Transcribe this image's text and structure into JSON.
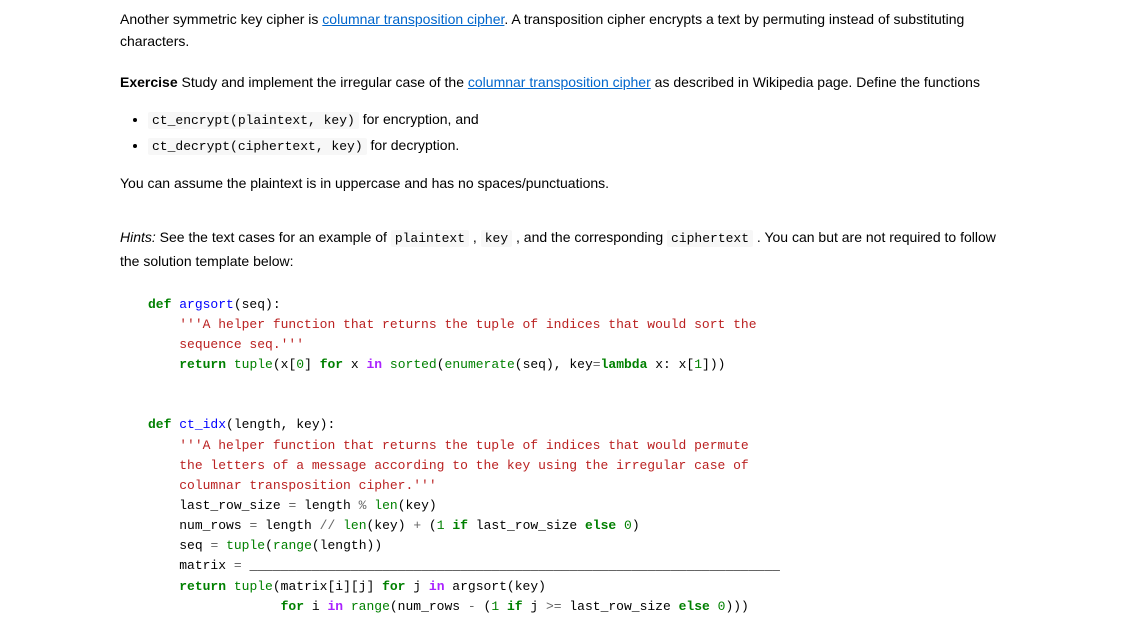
{
  "para1_pre": "Another symmetric key cipher is ",
  "para1_link": "columnar transposition cipher",
  "para1_post": ". A transposition cipher encrypts a text by permuting instead of substituting characters.",
  "para2_heading": "Exercise",
  "para2_pre": " Study and implement the irregular case of the ",
  "para2_link": "columnar transposition cipher",
  "para2_post": " as described in Wikipedia page. Define the functions",
  "li1_code": "ct_encrypt(plaintext, key)",
  "li1_text": " for encryption, and",
  "li2_code": "ct_decrypt(ciphertext, key)",
  "li2_text": " for decryption.",
  "para3": "You can assume the plaintext is in uppercase and has no spaces/punctuations.",
  "para4_hints": "Hints:",
  "para4_a": " See the text cases for an example of ",
  "para4_code1": "plaintext",
  "para4_b": " , ",
  "para4_code2": "key",
  "para4_c": " , and the corresponding ",
  "para4_code3": "ciphertext",
  "para4_d": " . You can but are not required to follow the solution template below:",
  "code": {
    "def": "def",
    "argsort": "argsort",
    "seq_param": "(seq):",
    "doc1": "'''A helper function that returns the tuple of indices that would sort the",
    "doc1b": "sequence seq.'''",
    "return": "return",
    "tuple": "tuple",
    "argsort_expr_a": "(x[",
    "zero": "0",
    "argsort_expr_b": "] ",
    "for": "for",
    "argsort_expr_c": " x ",
    "in": "in",
    "sorted": "sorted",
    "enumerate": "enumerate",
    "argsort_expr_d": "(seq), key",
    "eq": "=",
    "lambda": "lambda",
    "argsort_expr_e": " x: x[",
    "one": "1",
    "argsort_expr_f": "]))",
    "ct_idx": "ct_idx",
    "ct_idx_param": "(length, key):",
    "doc2a": "'''A helper function that returns the tuple of indices that would permute",
    "doc2b": "the letters of a message according to the key using the irregular case of",
    "doc2c": "columnar transposition cipher.'''",
    "line_lrs_a": "last_row_size ",
    "line_lrs_b": " length ",
    "pct": "%",
    "len": "len",
    "key_call": "(key)",
    "line_nr_a": "num_rows ",
    "line_nr_b": " length ",
    "floordiv": "//",
    "line_nr_c": "(key) ",
    "plus": "+",
    "line_nr_d": " (",
    "if": "if",
    "line_nr_e": " last_row_size ",
    "else": "else",
    "line_nr_f": ")",
    "line_seq_a": "seq ",
    "range": "range",
    "line_seq_b": "(length))",
    "line_matrix_a": "matrix ",
    "line_matrix_b": " ____________________________________________________________________",
    "ret_a": "(matrix[i][j] ",
    "ret_b": " j ",
    "ret_c": " argsort(key)",
    "ret2_a": " i ",
    "ret2_b": "(num_rows ",
    "minus": "-",
    "ret2_c": " (",
    "ret2_d": " j ",
    "ge": ">=",
    "ret2_e": " last_row_size ",
    "ret2_f": ")))"
  }
}
